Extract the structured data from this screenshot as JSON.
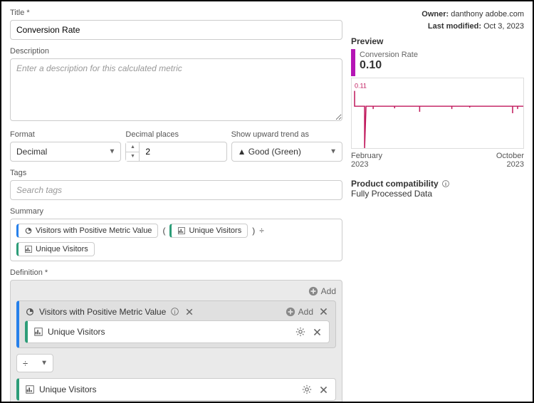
{
  "owner_label": "Owner:",
  "owner_value": "danthony adobe.com",
  "modified_label": "Last modified:",
  "modified_value": "Oct 3, 2023",
  "title_label": "Title",
  "title_value": "Conversion Rate",
  "desc_label": "Description",
  "desc_placeholder": "Enter a description for this calculated metric",
  "format_label": "Format",
  "format_value": "Decimal",
  "decimal_label": "Decimal places",
  "decimal_value": "2",
  "trend_label": "Show upward trend as",
  "trend_value": "▲ Good (Green)",
  "tags_label": "Tags",
  "tags_placeholder": "Search tags",
  "summary_label": "Summary",
  "summary": {
    "seg": "Visitors with Positive Metric Value",
    "metric": "Unique Visitors",
    "lparen": "(",
    "rparen": ")",
    "div": "÷"
  },
  "definition_label": "Definition",
  "add_label": "Add",
  "seg_name": "Visitors with Positive Metric Value",
  "metric_name": "Unique Visitors",
  "preview_label": "Preview",
  "preview_value": "0.10",
  "preview_metric_name": "Conversion Rate",
  "date_start": "February 2023",
  "date_end": "October 2023",
  "compat_label": "Product compatibility",
  "compat_value": "Fully Processed Data",
  "chart_data": {
    "type": "line",
    "title": "Conversion Rate",
    "ylim": [
      0,
      0.11
    ],
    "y_tick": "0.11",
    "x_range": [
      "February 2023",
      "October 2023"
    ],
    "value": 0.1,
    "series": [
      {
        "name": "Conversion Rate",
        "note": "approximate values read from sparkline; baseline ~0.10 with initial spike ~0.11 and occasional dips",
        "values": [
          0.11,
          0.1,
          0.1,
          0.0,
          0.1,
          0.1,
          0.1,
          0.1,
          0.1,
          0.09,
          0.1,
          0.1,
          0.1,
          0.09,
          0.1,
          0.1,
          0.1,
          0.1,
          0.1,
          0.09,
          0.1
        ]
      }
    ]
  }
}
